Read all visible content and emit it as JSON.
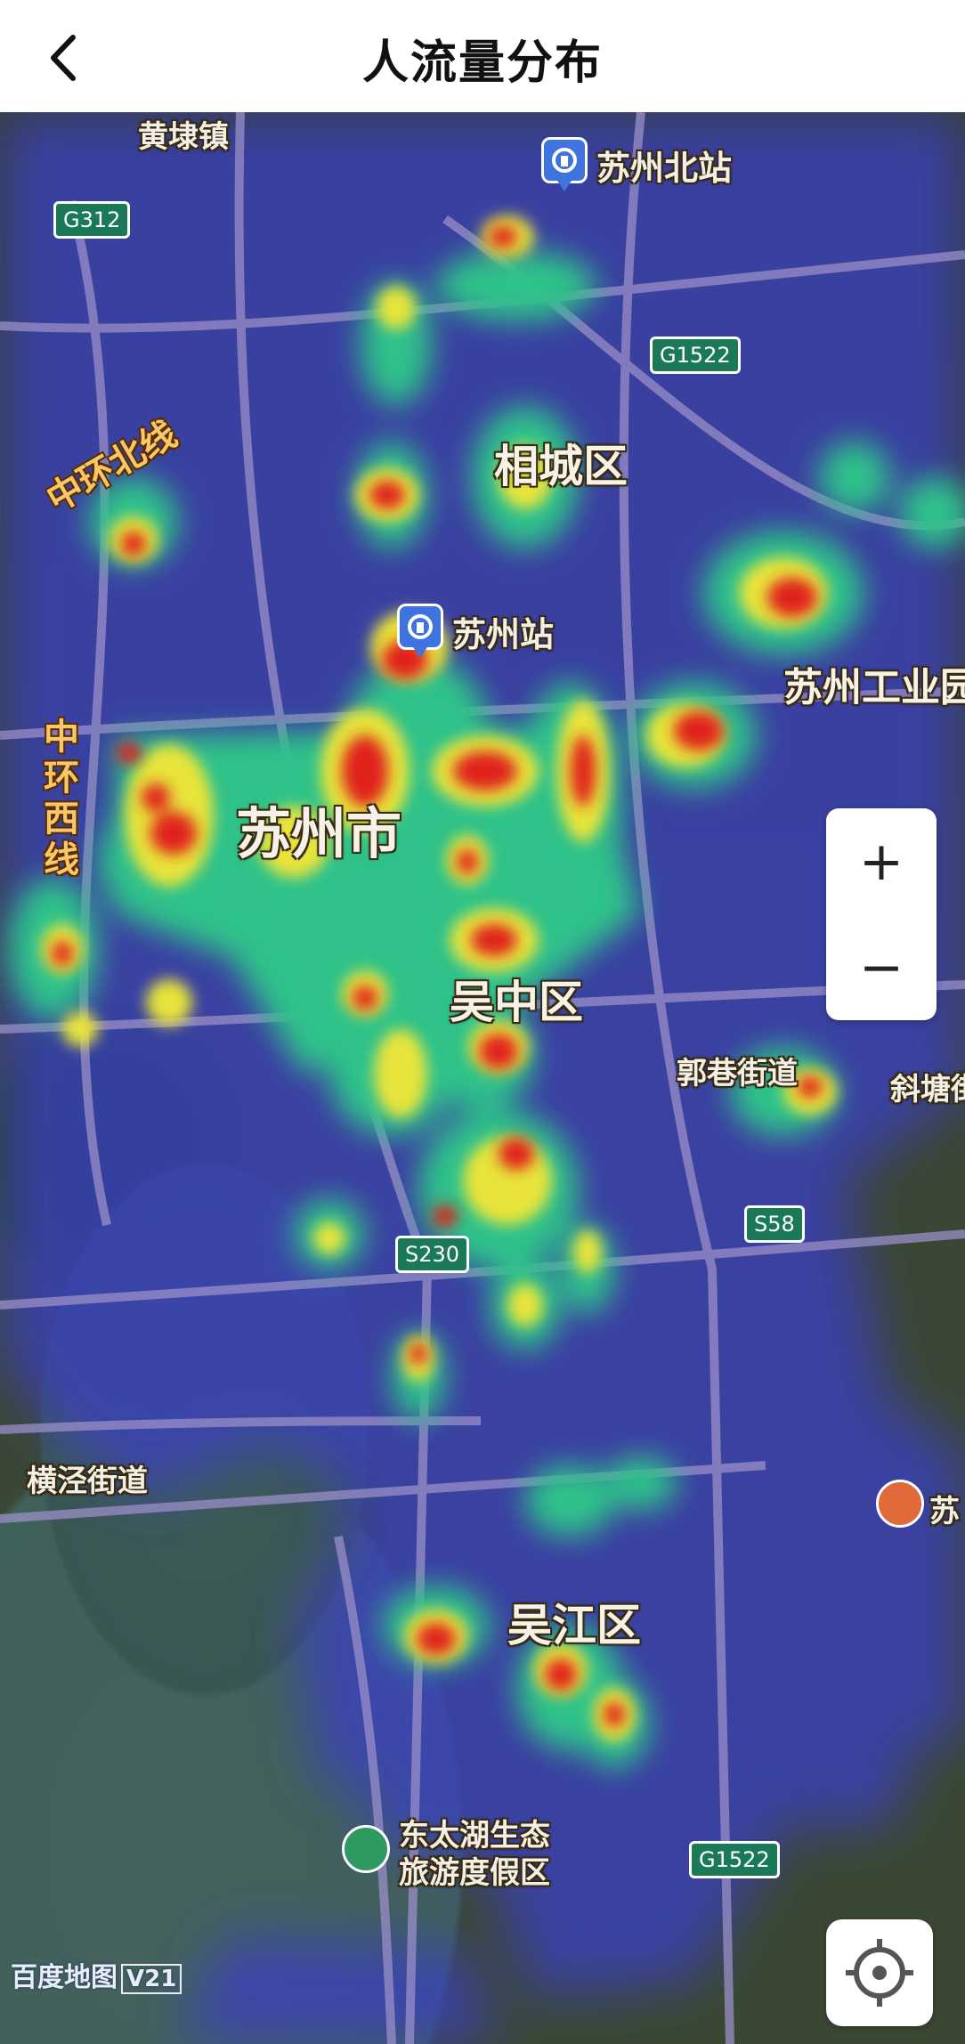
{
  "header": {
    "title": "人流量分布"
  },
  "map": {
    "districts": [
      {
        "key": "xiangcheng",
        "name": "相城区"
      },
      {
        "key": "suzhou_city",
        "name": "苏州市"
      },
      {
        "key": "wuzhong",
        "name": "吴中区"
      },
      {
        "key": "wujiang",
        "name": "吴江区"
      },
      {
        "key": "industrial",
        "name": "苏州工业园"
      }
    ],
    "places": {
      "huangdai": "黄埭镇",
      "guoxiang": "郭巷街道",
      "xietang": "斜塘街",
      "hengjing": "横泾街道",
      "su_poi": "苏",
      "taihu_line1": "东太湖生态",
      "taihu_line2": "旅游度假区"
    },
    "stations": {
      "north": "苏州北站",
      "main": "苏州站"
    },
    "ring_roads": {
      "north": "中环北线",
      "west": "中环西线"
    },
    "road_shields": {
      "g312": "G312",
      "g1522_top": "G1522",
      "s58": "S58",
      "s230": "S230",
      "g1522_bottom": "G1522"
    },
    "controls": {
      "zoom_in": "+",
      "zoom_out": "−"
    },
    "attribution": {
      "logo": "百度地图",
      "version": "V21"
    },
    "heat_colors": {
      "low": "#3a3fc0",
      "mid": "#2fc28a",
      "high": "#e8e43a",
      "peak": "#e0201a"
    }
  }
}
